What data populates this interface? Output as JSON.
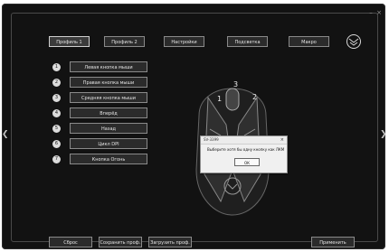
{
  "window": {
    "minimize_glyph": "–",
    "close_glyph": "×",
    "left_nav_icon": "chevron-left-icon",
    "right_nav_icon": "chevron-right-icon",
    "logo_icon": "brand-logo-icon"
  },
  "tabs": [
    "Профиль 1",
    "Профиль 2",
    "Настройки",
    "Подсветка",
    "Макро"
  ],
  "button_assignments": [
    {
      "number": "1",
      "label": "Левая кнопка мыши"
    },
    {
      "number": "2",
      "label": "Правая кнопка мыши"
    },
    {
      "number": "3",
      "label": "Средняя кнопка мыши"
    },
    {
      "number": "4",
      "label": "Вперёд"
    },
    {
      "number": "5",
      "label": "Назад"
    },
    {
      "number": "6",
      "label": "Цикл DPI"
    },
    {
      "number": "7",
      "label": "Кнопка Огонь"
    }
  ],
  "mouse_callouts": [
    "1",
    "2",
    "3"
  ],
  "dialog": {
    "title": "SV-3399",
    "message": "Выберите хотя бы одну кнопку как ЛКМ",
    "ok_label": "ОК"
  },
  "bottom_bar": {
    "reset_label": "Сброс",
    "save_label": "Сохранить проф.",
    "load_label": "Загрузить проф.",
    "apply_label": "Применить"
  },
  "colors": {
    "background": "#121212",
    "button": "#2b2b2b",
    "border": "#8a8a8a",
    "text": "#e5e5e5",
    "dialog_bg": "#f0f0f0"
  }
}
